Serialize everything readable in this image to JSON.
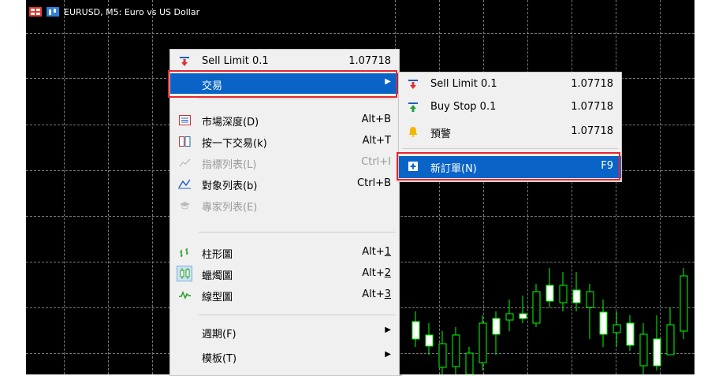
{
  "window": {
    "title": "EURUSD, M5:  Euro vs US Dollar"
  },
  "context_menu": {
    "items": [
      {
        "label": "Sell Limit 0.1",
        "shortcut": "1.07718",
        "icon": "sell-arrow-icon"
      },
      {
        "label": "交易",
        "shortcut": "",
        "icon": "none",
        "submenu": true
      },
      {
        "label": "市場深度(D)",
        "shortcut": "Alt+B",
        "icon": "depth-of-market-icon"
      },
      {
        "label": "按一下交易(k)",
        "shortcut": "Alt+T",
        "icon": "one-click-trading-icon"
      },
      {
        "label": "指標列表(L)",
        "shortcut": "Ctrl+I",
        "icon": "indicators-icon",
        "disabled": true
      },
      {
        "label": "對象列表(b)",
        "shortcut": "Ctrl+B",
        "icon": "objects-icon"
      },
      {
        "label": "專家列表(E)",
        "shortcut": "",
        "icon": "experts-icon",
        "disabled": true
      },
      {
        "label": "柱形圖",
        "shortcut_prefix": "Alt+",
        "shortcut_key": "1",
        "icon": "bar-chart-icon"
      },
      {
        "label": "蠟燭圖",
        "shortcut_prefix": "Alt+",
        "shortcut_key": "2",
        "icon": "candlestick-icon"
      },
      {
        "label": "線型圖",
        "shortcut_prefix": "Alt+",
        "shortcut_key": "3",
        "icon": "line-chart-icon"
      },
      {
        "label": "週期(F)",
        "icon": "none",
        "submenu": true
      },
      {
        "label": "模板(T)",
        "icon": "none",
        "submenu": true
      }
    ]
  },
  "trade_submenu": {
    "items": [
      {
        "label": "Sell Limit 0.1",
        "shortcut": "1.07718",
        "icon": "sell-arrow-icon"
      },
      {
        "label": "Buy Stop 0.1",
        "shortcut": "1.07718",
        "icon": "buy-arrow-icon"
      },
      {
        "label": "預警",
        "shortcut": "1.07718",
        "icon": "alert-bell-icon"
      },
      {
        "label": "新訂單(N)",
        "shortcut": "F9",
        "icon": "new-order-icon"
      }
    ]
  },
  "colors": {
    "chart_background": "#000000",
    "grid": "#777777",
    "candle_up": "#ffffff",
    "candle_line": "#00ff00",
    "selection": "#0a64c8",
    "highlight_box": "#e8262c"
  }
}
